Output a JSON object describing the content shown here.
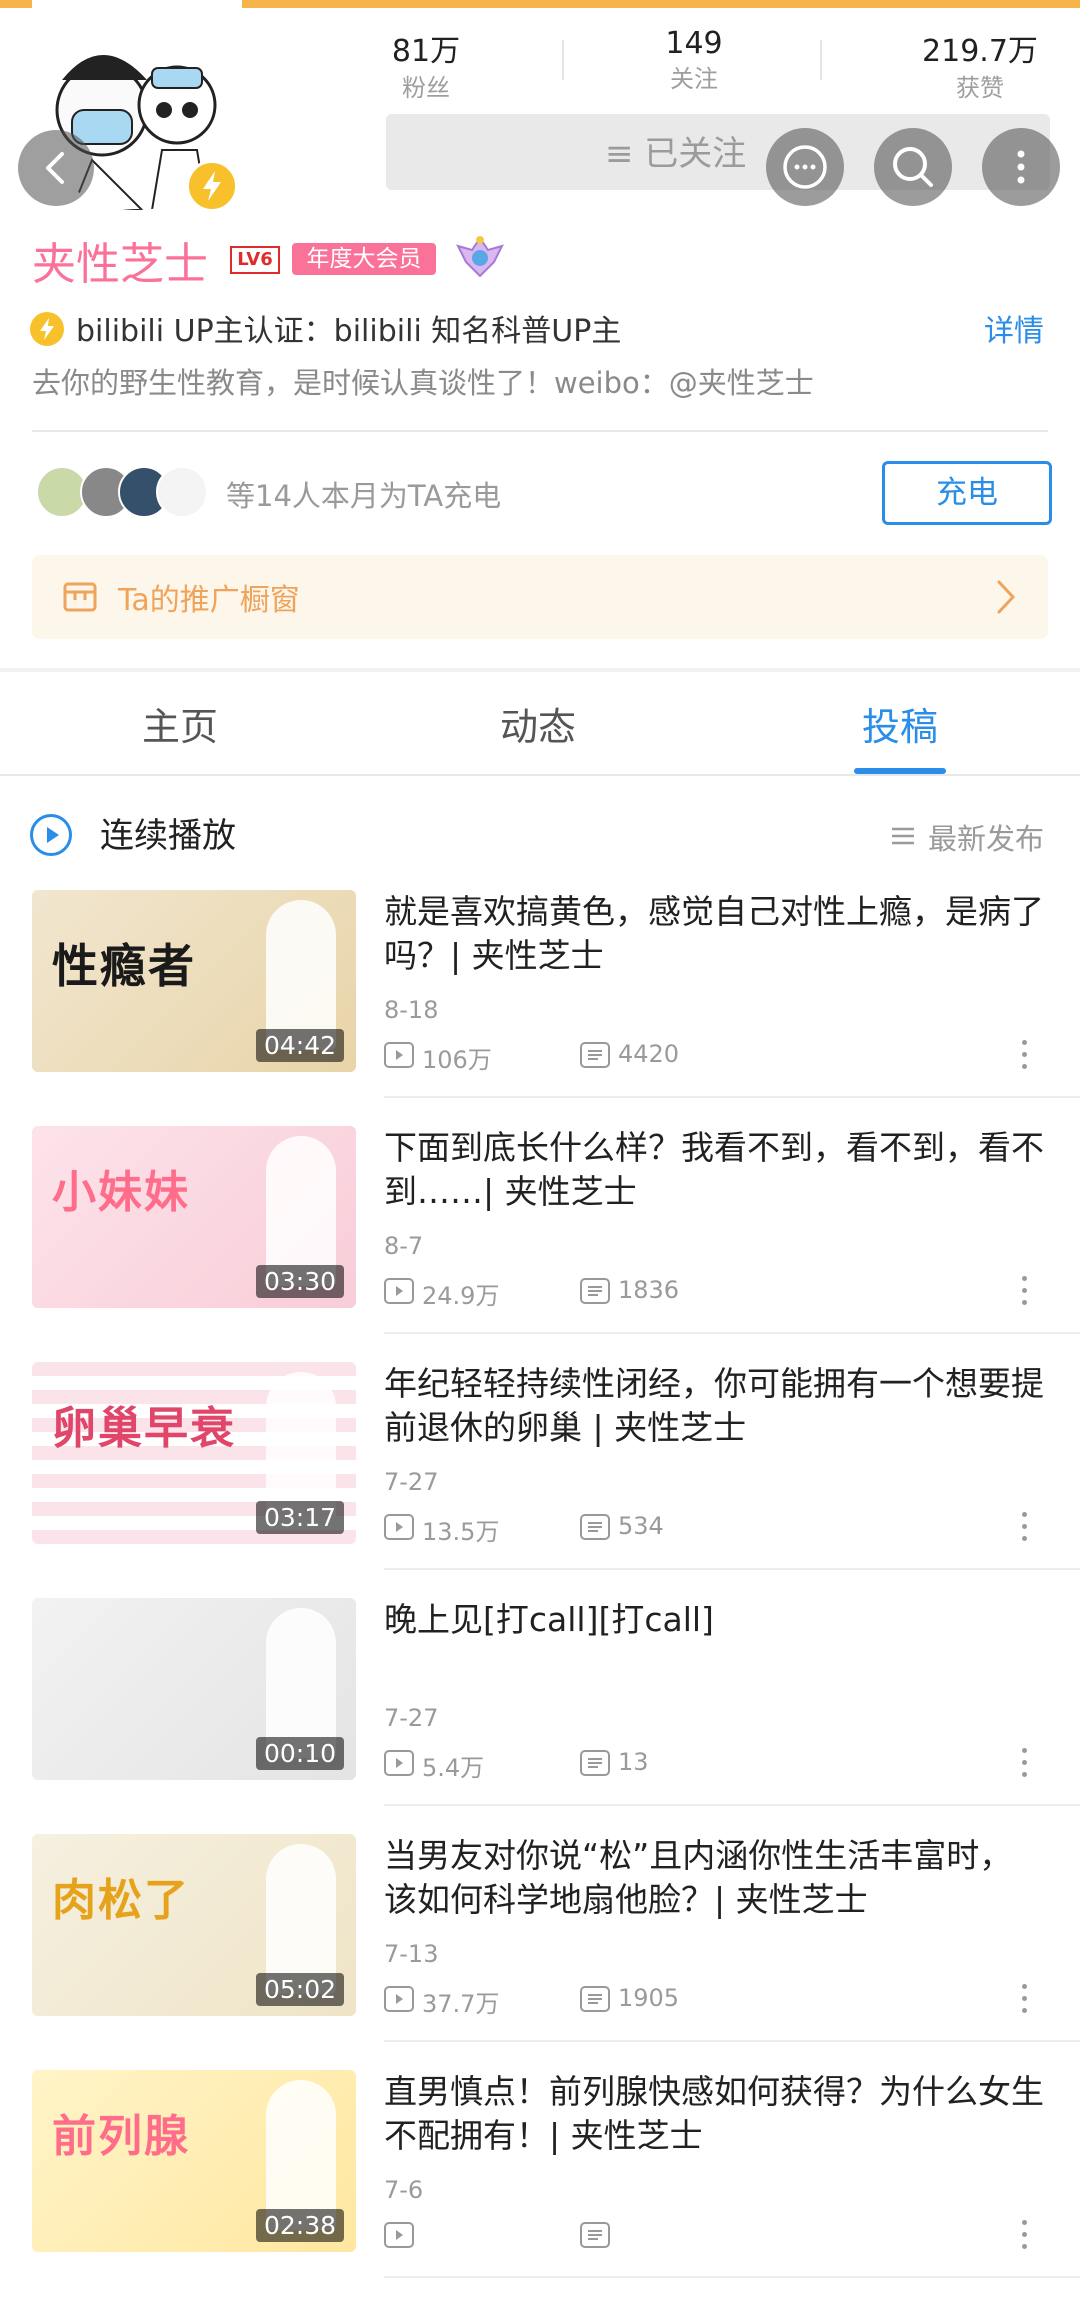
{
  "header": {
    "stats": [
      {
        "value": "81万",
        "label": "粉丝"
      },
      {
        "value": "149",
        "label": "关注"
      },
      {
        "value": "219.7万",
        "label": "获赞"
      }
    ],
    "follow_label": "≡ 已关注",
    "accent": "#fb7299",
    "blue": "#2a8ee8"
  },
  "profile": {
    "name": "夹性芝士",
    "level": "LV6",
    "vip_label": "年度大会员",
    "cert_text": "bilibili UP主认证：bilibili 知名科普UP主",
    "detail_label": "详情",
    "sign": "去你的野生性教育，是时候认真谈性了！weibo：@夹性芝士"
  },
  "charge": {
    "text": "等14人本月为TA充电",
    "button": "充电"
  },
  "shop": {
    "label": "Ta的推广橱窗"
  },
  "tabs": [
    {
      "label": "主页"
    },
    {
      "label": "动态"
    },
    {
      "label": "投稿"
    }
  ],
  "list_header": {
    "play_all": "连续播放",
    "sort": "最新发布"
  },
  "videos": [
    {
      "title": "就是喜欢搞黄色，感觉自己对性上瘾，是病了吗？| 夹性芝士",
      "date": "8-18",
      "views": "106万",
      "comments": "4420",
      "duration": "04:42",
      "thumb_text": "性瘾者"
    },
    {
      "title": "下面到底长什么样？我看不到，看不到，看不到……| 夹性芝士",
      "date": "8-7",
      "views": "24.9万",
      "comments": "1836",
      "duration": "03:30",
      "thumb_text": "小妹妹"
    },
    {
      "title": "年纪轻轻持续性闭经，你可能拥有一个想要提前退休的卵巢 | 夹性芝士",
      "date": "7-27",
      "views": "13.5万",
      "comments": "534",
      "duration": "03:17",
      "thumb_text": "卵巢早衰"
    },
    {
      "title": "晚上见[打call][打call]",
      "date": "7-27",
      "views": "5.4万",
      "comments": "13",
      "duration": "00:10",
      "thumb_text": ""
    },
    {
      "title": "当男友对你说“松”且内涵你性生活丰富时，该如何科学地扇他脸？| 夹性芝士",
      "date": "7-13",
      "views": "37.7万",
      "comments": "1905",
      "duration": "05:02",
      "thumb_text": "肉松了"
    },
    {
      "title": "直男慎点！前列腺快感如何获得？为什么女生不配拥有！| 夹性芝士",
      "date": "7-6",
      "views": "",
      "comments": "",
      "duration": "02:38",
      "thumb_text": "前列腺"
    }
  ]
}
